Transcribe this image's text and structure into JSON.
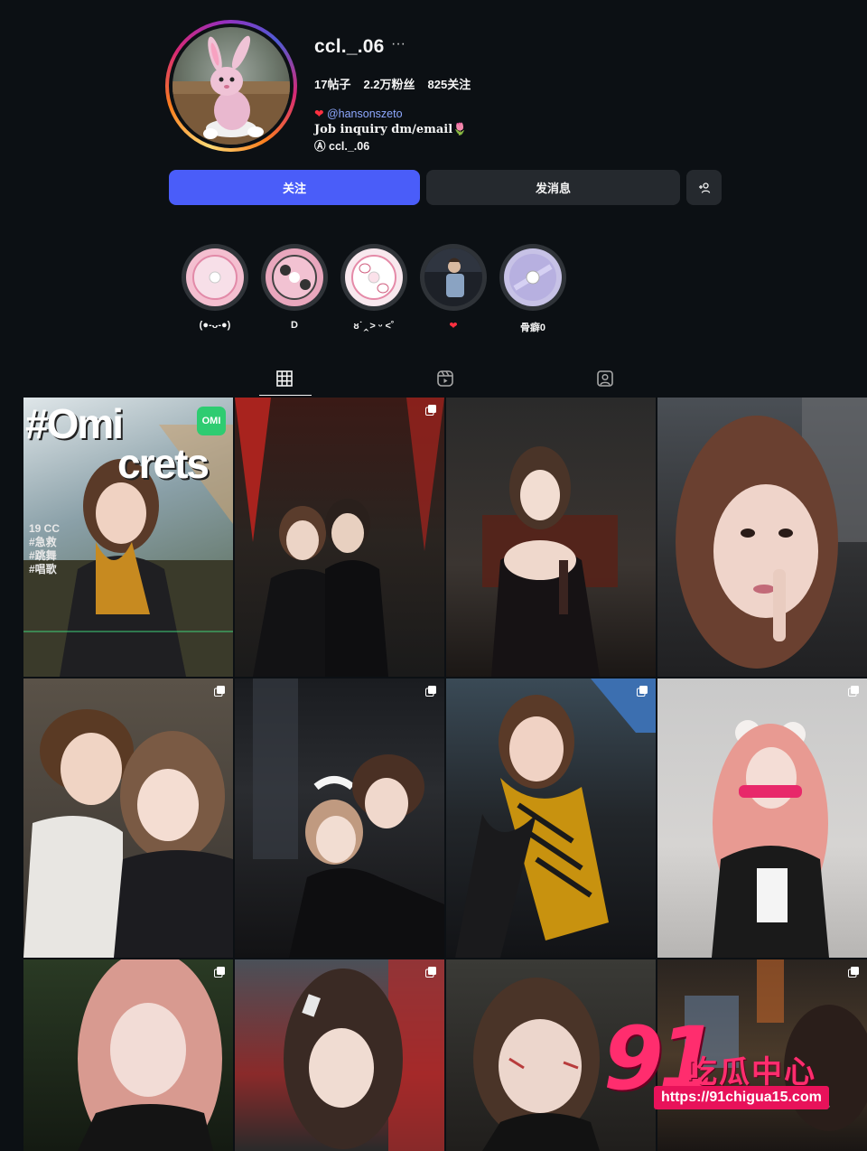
{
  "profile": {
    "username": "ccl._.06",
    "more": "···",
    "stats": {
      "posts": "17帖子",
      "followers": "2.2万粉丝",
      "following": "825关注"
    },
    "bio": {
      "heart": "❤",
      "link_handle": "@hansonszeto",
      "line2": "Job inquiry dm/email",
      "tulip": "🌷",
      "threads_handle": "ccl._.06"
    }
  },
  "buttons": {
    "follow": "关注",
    "message": "发消息",
    "add": "+☺"
  },
  "highlights": [
    {
      "label": "(●-ᴗ-●)",
      "icon": "cd-pink-icon"
    },
    {
      "label": "D",
      "icon": "cd-kuromi-icon"
    },
    {
      "label": "ᴕ˙‸> ᵕ <˚",
      "icon": "cd-hello-kitty-icon"
    },
    {
      "label": "❤",
      "icon": "photo-boy-icon"
    },
    {
      "label": "骨癖0",
      "icon": "cd-lavender-icon"
    }
  ],
  "tabs": [
    {
      "name": "posts",
      "icon": "grid-icon",
      "active": true
    },
    {
      "name": "reels",
      "icon": "reels-icon",
      "active": false
    },
    {
      "name": "tagged",
      "icon": "tagged-icon",
      "active": false
    }
  ],
  "posts": [
    {
      "caption_overlay": "#Omi",
      "caption_overlay2": "crets",
      "badge": "OMI",
      "tags": "19 CC\n#急救\n#跳舞\n#唱歌",
      "multi": false
    },
    {
      "multi": true
    },
    {
      "multi": false
    },
    {
      "multi": false
    },
    {
      "multi": true
    },
    {
      "multi": true
    },
    {
      "multi": true
    },
    {
      "multi": true
    },
    {
      "multi": true
    },
    {
      "multi": false
    },
    {
      "multi": false
    },
    {
      "multi": true
    }
  ],
  "watermark": {
    "number": "91",
    "text": "吃瓜中心",
    "url": "https://91chigua15.com"
  },
  "msg_peek": "息",
  "colors": {
    "bg": "#0c1014",
    "follow": "#4a5df9",
    "secondary": "#25292e",
    "link": "#8ea8ff",
    "accent": "#ff2d6e"
  }
}
